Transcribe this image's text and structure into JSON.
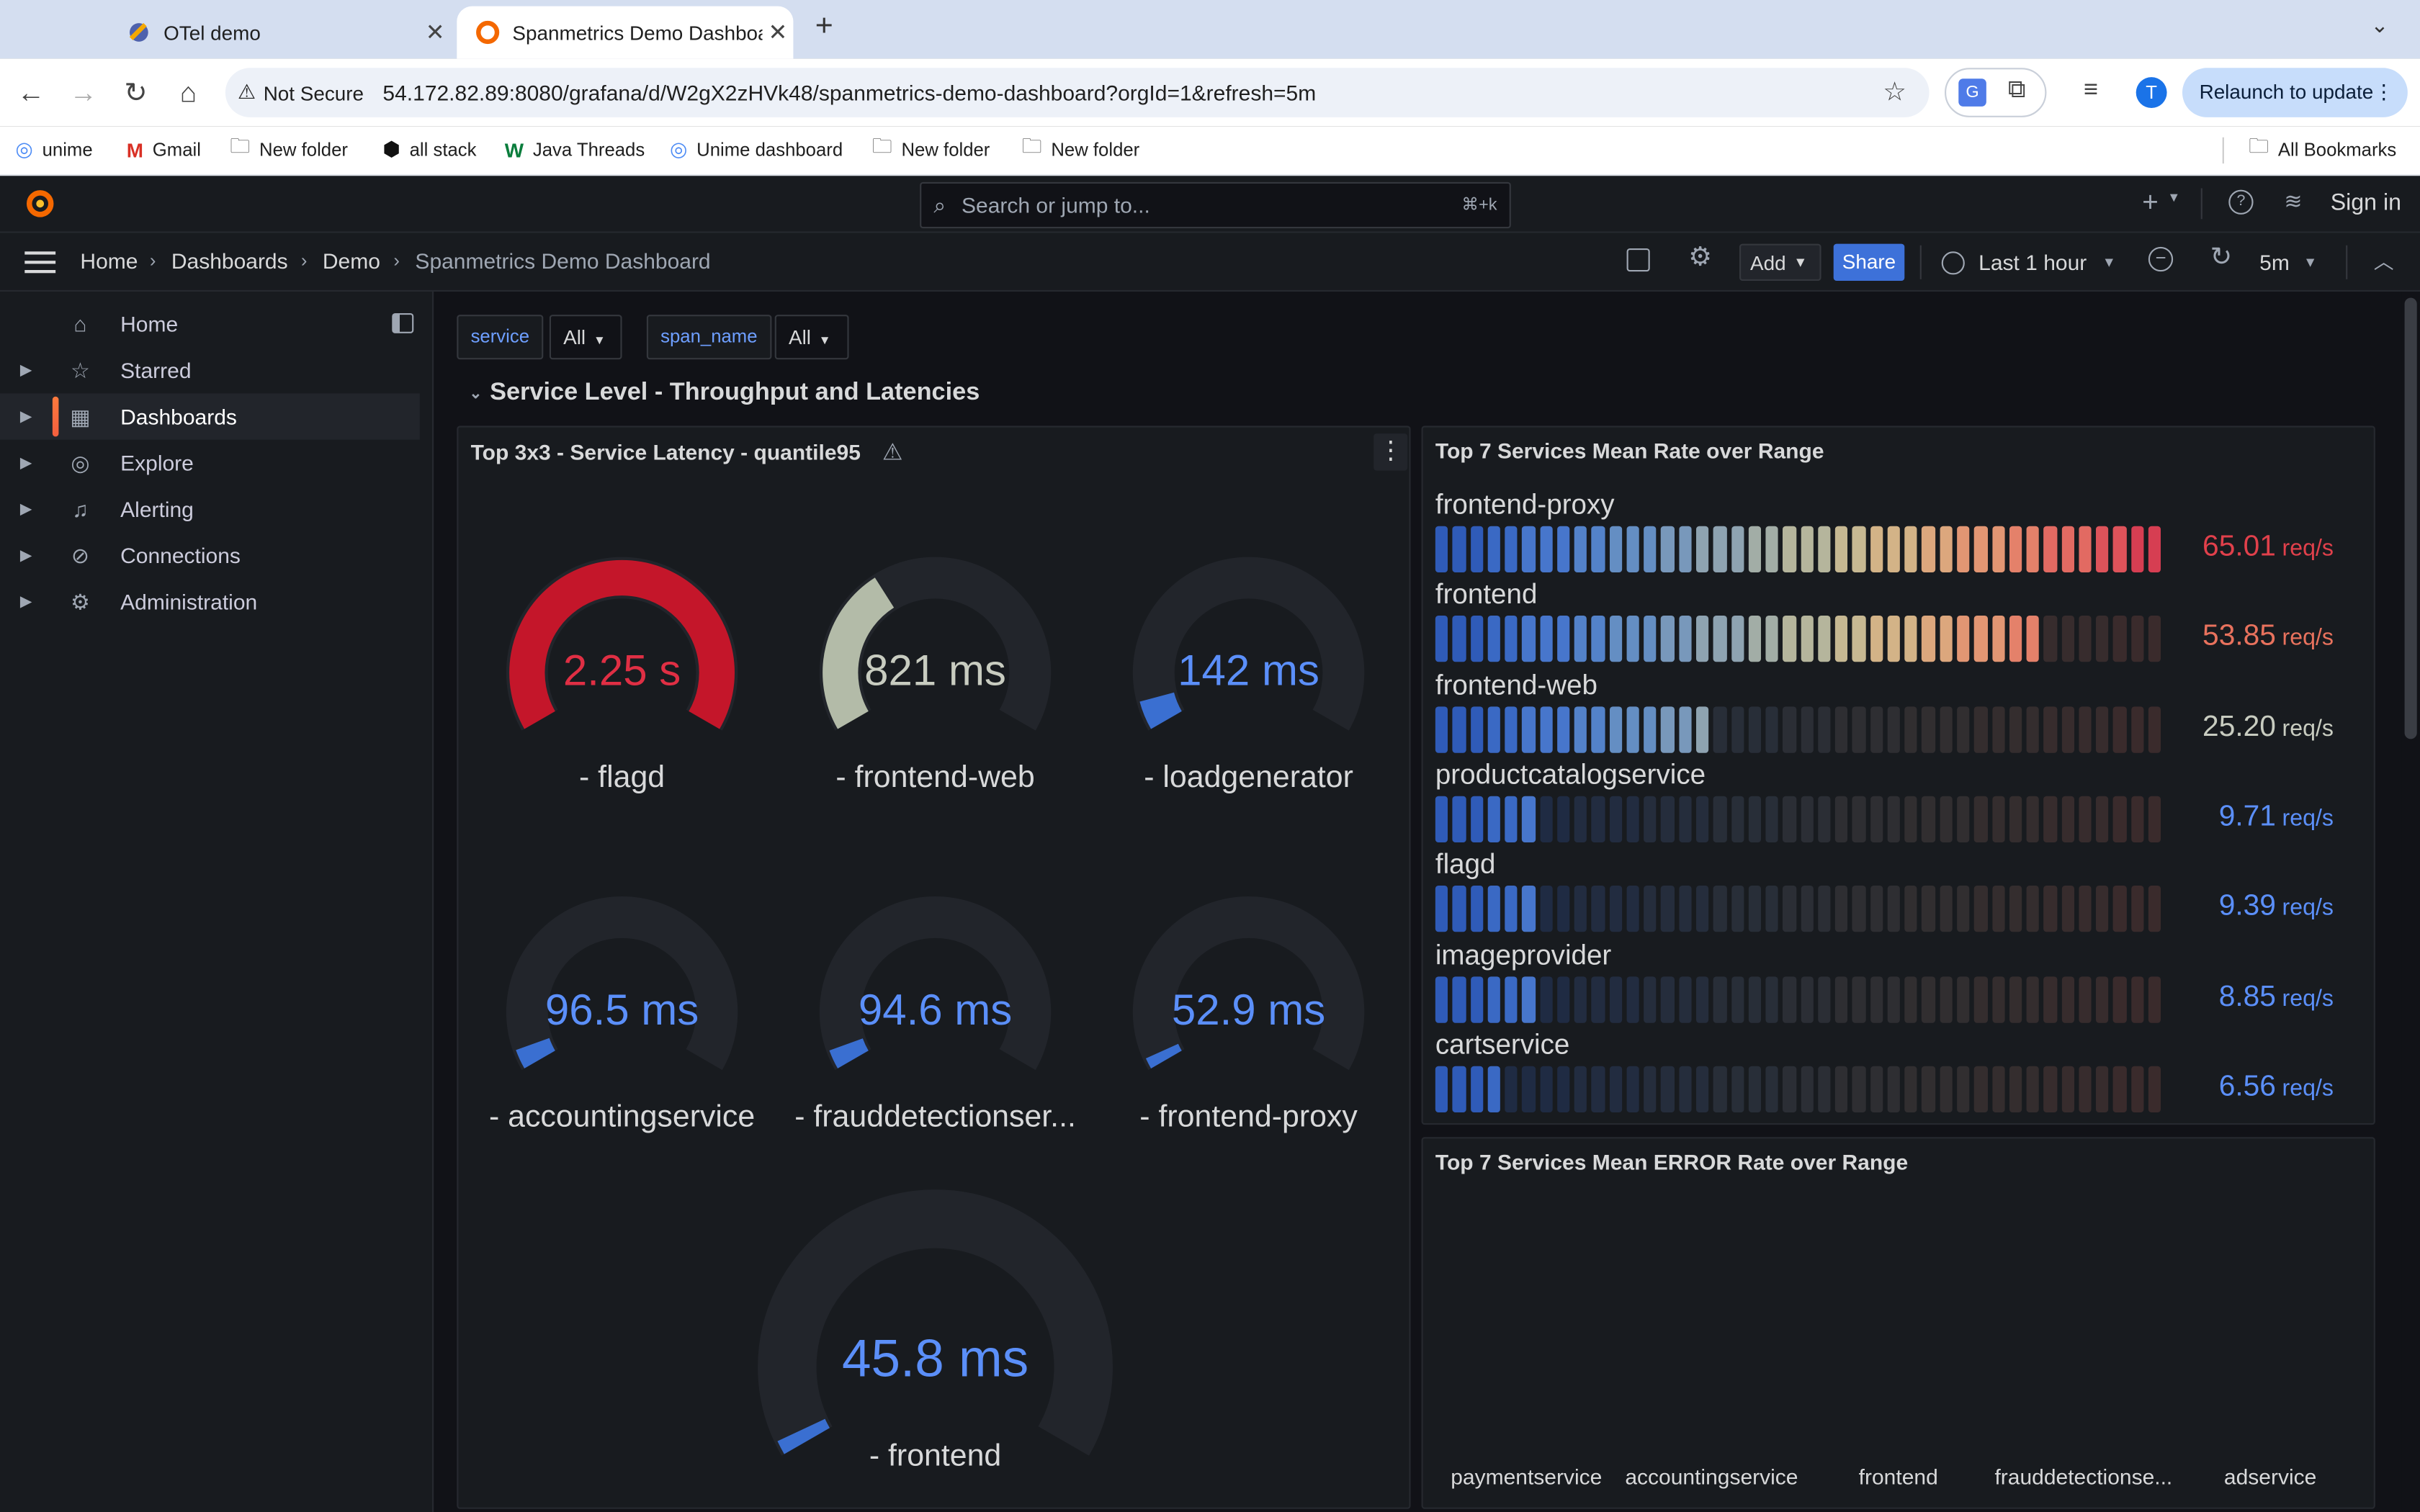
{
  "browser": {
    "tabs": [
      {
        "title": "OTel demo"
      },
      {
        "title": "Spanmetrics Demo Dashboard"
      }
    ],
    "url_security": "Not Secure",
    "url": "54.172.82.89:8080/grafana/d/W2gX2zHVk48/spanmetrics-demo-dashboard?orgId=1&refresh=5m",
    "profile_initial": "T",
    "relaunch_label": "Relaunch to update",
    "bookmarks": [
      "unime",
      "Gmail",
      "New folder",
      "all stack",
      "Java Threads",
      "Unime dashboard",
      "New folder",
      "New folder"
    ],
    "all_bookmarks": "All Bookmarks"
  },
  "grafana": {
    "search_placeholder": "Search or jump to...",
    "search_shortcut": "⌘+k",
    "sign_in": "Sign in",
    "breadcrumbs": [
      "Home",
      "Dashboards",
      "Demo",
      "Spanmetrics Demo Dashboard"
    ],
    "add_label": "Add",
    "share_label": "Share",
    "time_range": "Last 1 hour",
    "refresh_interval": "5m",
    "sidebar": [
      {
        "label": "Home",
        "icon": "home-icon"
      },
      {
        "label": "Starred",
        "icon": "star-icon"
      },
      {
        "label": "Dashboards",
        "icon": "dashboards-grid-icon"
      },
      {
        "label": "Explore",
        "icon": "compass-icon"
      },
      {
        "label": "Alerting",
        "icon": "bell-icon"
      },
      {
        "label": "Connections",
        "icon": "connections-icon"
      },
      {
        "label": "Administration",
        "icon": "gear-icon"
      }
    ],
    "variables": [
      {
        "name": "service",
        "value": "All"
      },
      {
        "name": "span_name",
        "value": "All"
      }
    ],
    "row_title": "Service Level - Throughput and Latencies",
    "latency_panel": {
      "title": "Top 3x3 - Service Latency - quantile95",
      "gauges": [
        {
          "value": "2.25 s",
          "label": "- flagd",
          "fraction": 1.0,
          "color": "#c4162a"
        },
        {
          "value": "821 ms",
          "label": "- frontend-web",
          "fraction": 0.365,
          "color": "#b3bba8"
        },
        {
          "value": "142 ms",
          "label": "- loadgenerator",
          "fraction": 0.063,
          "color": "#3a6fd1"
        },
        {
          "value": "96.5 ms",
          "label": "- accountingservice",
          "fraction": 0.043,
          "color": "#3a6fd1"
        },
        {
          "value": "94.6 ms",
          "label": "- frauddetectionser...",
          "fraction": 0.042,
          "color": "#3a6fd1"
        },
        {
          "value": "52.9 ms",
          "label": "- frontend-proxy",
          "fraction": 0.024,
          "color": "#3a6fd1"
        },
        {
          "value": "45.8 ms",
          "label": "- frontend",
          "fraction": 0.02,
          "color": "#3a6fd1"
        }
      ]
    },
    "rate_panel": {
      "title": "Top 7 Services Mean Rate over Range",
      "unit": "req/s",
      "max": 65.01,
      "rows": [
        {
          "name": "frontend-proxy",
          "value": "65.01",
          "num": 65.01,
          "color": "#e0404b"
        },
        {
          "name": "frontend",
          "value": "53.85",
          "num": 53.85,
          "color": "#e8725d"
        },
        {
          "name": "frontend-web",
          "value": "25.20",
          "num": 25.2,
          "color": "#c8ccc0"
        },
        {
          "name": "productcatalogservice",
          "value": "9.71",
          "num": 9.71,
          "color": "#5b8ff9"
        },
        {
          "name": "flagd",
          "value": "9.39",
          "num": 9.39,
          "color": "#5b8ff9"
        },
        {
          "name": "imageprovider",
          "value": "8.85",
          "num": 8.85,
          "color": "#5b8ff9"
        },
        {
          "name": "cartservice",
          "value": "6.56",
          "num": 6.56,
          "color": "#5b8ff9"
        }
      ]
    },
    "error_panel": {
      "title": "Top 7 Services Mean ERROR Rate over Range",
      "x_labels": [
        "paymentservice",
        "accountingservice",
        "frontend",
        "frauddetectionse...",
        "adservice"
      ]
    }
  }
}
